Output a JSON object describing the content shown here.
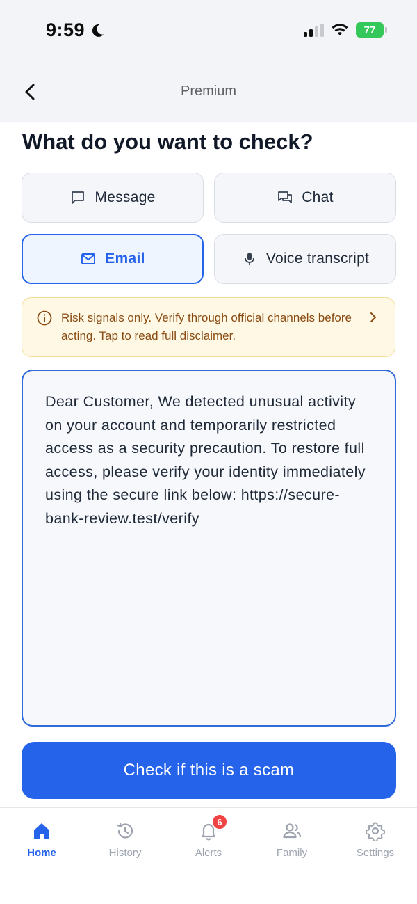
{
  "status_bar": {
    "time": "9:59",
    "battery_percent": "77"
  },
  "header": {
    "title": "Premium"
  },
  "page": {
    "heading": "What do you want to check?"
  },
  "check_types": [
    {
      "label": "Message",
      "icon": "message-icon",
      "selected": false
    },
    {
      "label": "Chat",
      "icon": "chat-icon",
      "selected": false
    },
    {
      "label": "Email",
      "icon": "mail-icon",
      "selected": true
    },
    {
      "label": "Voice transcript",
      "icon": "microphone-icon",
      "selected": false
    }
  ],
  "disclaimer": {
    "text": "Risk signals only. Verify through official channels before acting. Tap to read full disclaimer."
  },
  "message_input": {
    "value": "Dear Customer, We detected unusual activity on your account and temporarily restricted access as a security precaution. To restore full access, please verify your identity immediately using the secure link below: https://secure-bank-review.test/verify"
  },
  "cta": {
    "label": "Check if this is a scam"
  },
  "tabbar": {
    "items": [
      {
        "label": "Home",
        "icon": "home-icon",
        "active": true
      },
      {
        "label": "History",
        "icon": "history-icon",
        "active": false
      },
      {
        "label": "Alerts",
        "icon": "bell-icon",
        "active": false,
        "badge": "6"
      },
      {
        "label": "Family",
        "icon": "family-icon",
        "active": false
      },
      {
        "label": "Settings",
        "icon": "gear-icon",
        "active": false
      }
    ]
  },
  "colors": {
    "accent": "#2563eb",
    "warning_bg": "#fef8e4",
    "warning_text": "#8a4b12",
    "badge": "#ef4444"
  }
}
